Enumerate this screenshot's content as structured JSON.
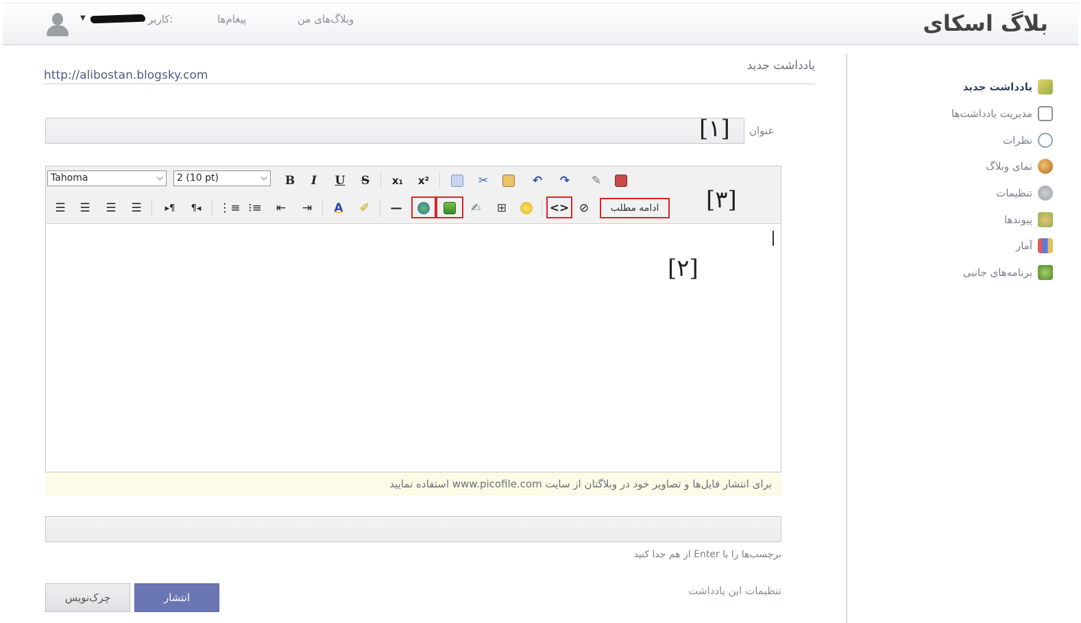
{
  "header": {
    "brand": "بلاگ اسکای",
    "user_label": "کاربر:",
    "nav_messages": "پیغام‌ها",
    "nav_my_blogs": "وبلاگ‌های من"
  },
  "sidebar": {
    "items": [
      {
        "label": "یادداشت جدید",
        "icon": "new-post-icon",
        "active": true
      },
      {
        "label": "مدیریت یادداشت‌ها",
        "icon": "manage-posts-icon"
      },
      {
        "label": "نظرات",
        "icon": "comments-icon"
      },
      {
        "label": "نمای وبلاگ",
        "icon": "blog-view-icon"
      },
      {
        "label": "تنظیمات",
        "icon": "settings-icon"
      },
      {
        "label": "پیوندها",
        "icon": "links-icon"
      },
      {
        "label": "آمار",
        "icon": "stats-icon"
      },
      {
        "label": "برنامه‌های جانبی",
        "icon": "plugins-icon"
      }
    ]
  },
  "main": {
    "page_heading": "یادداشت جدید",
    "blog_url": "http://alibostan.blogsky.com",
    "title_label": "عنوان",
    "markers": {
      "m1": "[۱]",
      "m2": "[۲]",
      "m3": "[۳]"
    },
    "editor": {
      "font_select": "Tahoma",
      "size_select": "2 (10 pt)",
      "more_button": "ادامه مطلب"
    },
    "notice": "برای انتشار فایل‌ها و تصاویر خود در وبلاگتان از سایت www.picofile.com استفاده نمایید",
    "tags_hint": "برچسب‌ها را با Enter از هم جدا کنید",
    "post_settings": "تنظیمات این یادداشت",
    "publish_button": "انتشار",
    "draft_button": "چرک‌نویس"
  },
  "colors": {
    "publish": "#6b77b5",
    "highlight": "#e02020",
    "notice_bg": "#fbfbe6"
  }
}
